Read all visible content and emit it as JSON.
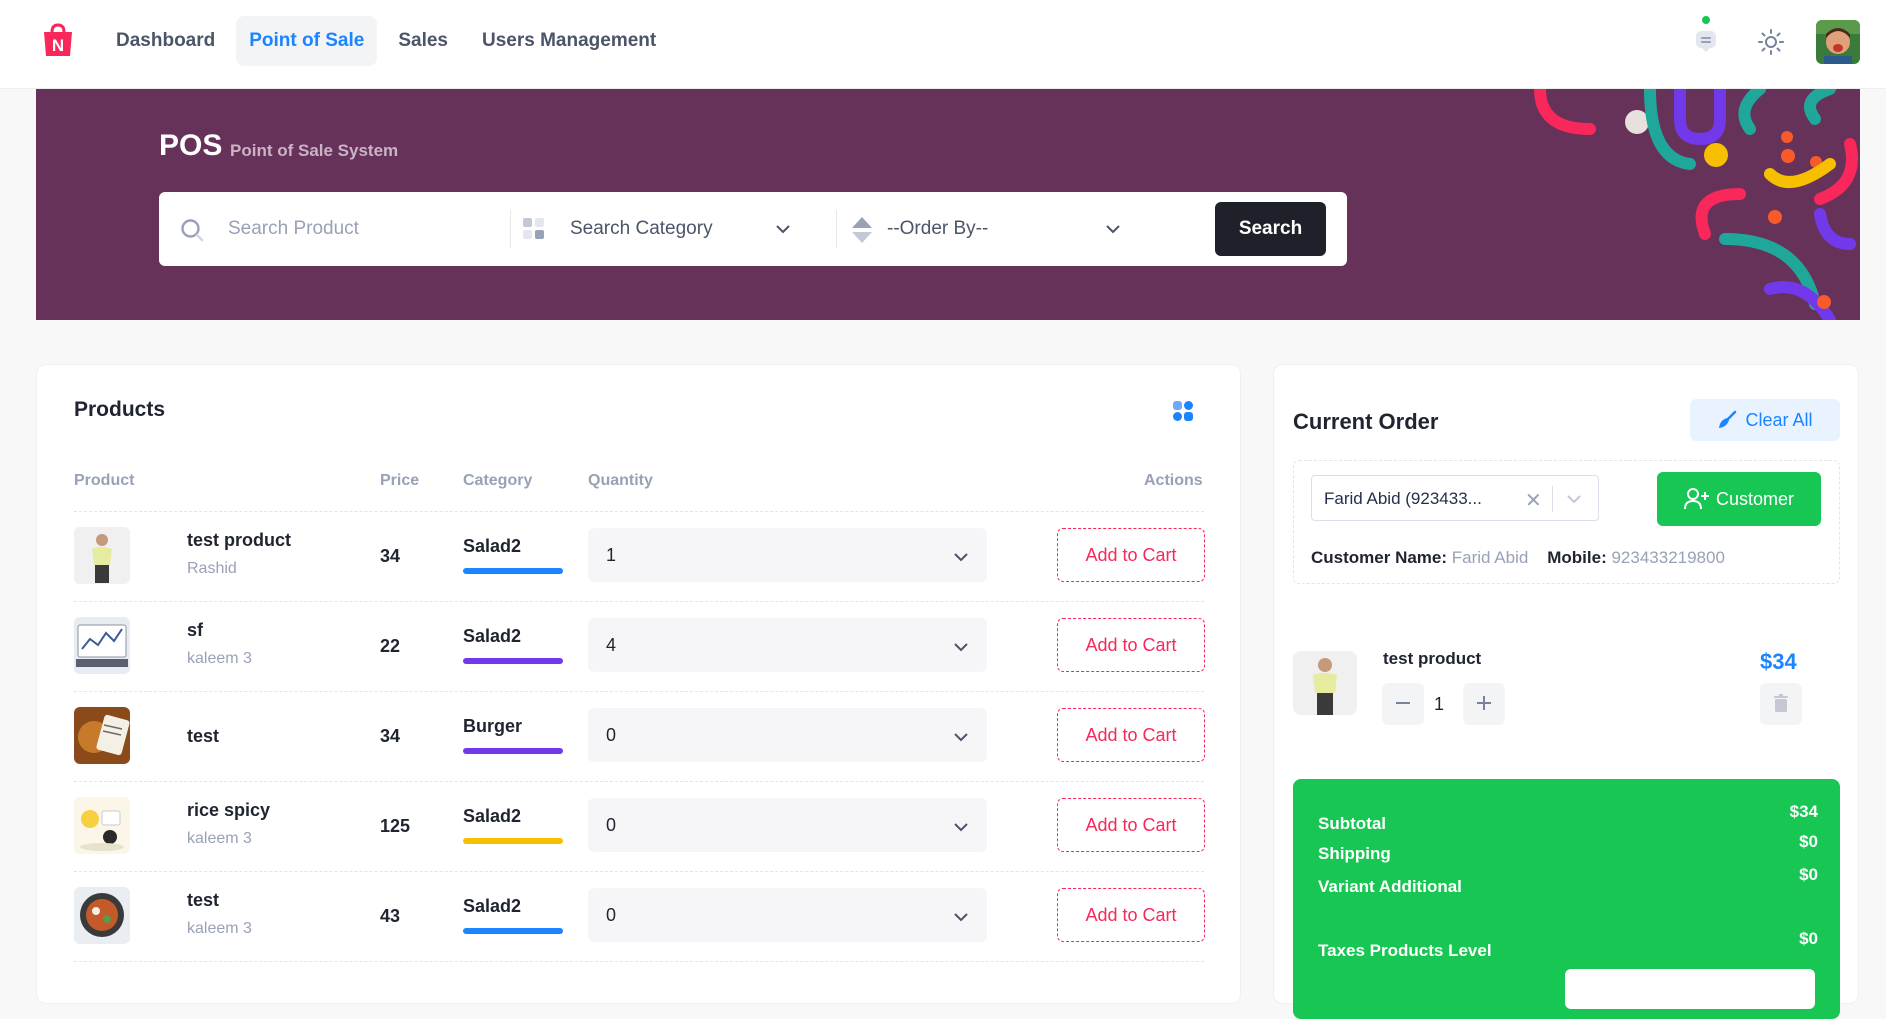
{
  "nav": {
    "items": [
      {
        "label": "Dashboard",
        "active": false
      },
      {
        "label": "Point of Sale",
        "active": true
      },
      {
        "label": "Sales",
        "active": false
      },
      {
        "label": "Users Management",
        "active": false
      }
    ]
  },
  "banner": {
    "title": "POS",
    "subtitle": "Point of Sale System",
    "search_placeholder": "Search Product",
    "category_placeholder": "Search Category",
    "order_by": "--Order By--",
    "search_button": "Search"
  },
  "products": {
    "title": "Products",
    "columns": {
      "product": "Product",
      "price": "Price",
      "category": "Category",
      "quantity": "Quantity",
      "actions": "Actions"
    },
    "add_label": "Add to Cart",
    "rows": [
      {
        "name": "test product",
        "vendor": "Rashid",
        "price": "34",
        "category": "Salad2",
        "cat_color": "#1b84ff",
        "qty": "1"
      },
      {
        "name": "sf",
        "vendor": "kaleem 3",
        "price": "22",
        "category": "Salad2",
        "cat_color": "#7239ea",
        "qty": "4"
      },
      {
        "name": "test",
        "vendor": "",
        "price": "34",
        "category": "Burger",
        "cat_color": "#7239ea",
        "qty": "0"
      },
      {
        "name": "rice spicy",
        "vendor": "kaleem 3",
        "price": "125",
        "category": "Salad2",
        "cat_color": "#f6c000",
        "qty": "0"
      },
      {
        "name": "test",
        "vendor": "kaleem 3",
        "price": "43",
        "category": "Salad2",
        "cat_color": "#1b84ff",
        "qty": "0"
      }
    ]
  },
  "order": {
    "title": "Current Order",
    "clear_all": "Clear All",
    "customer_select": "Farid Abid (923433...",
    "customer_button": "Customer",
    "customer_name_label": "Customer Name:",
    "customer_name": "Farid Abid",
    "mobile_label": "Mobile:",
    "mobile": "923433219800",
    "item": {
      "name": "test product",
      "price": "$34",
      "qty": "1"
    },
    "totals": [
      {
        "label": "Subtotal",
        "value": "$34"
      },
      {
        "label": "Shipping",
        "value": "$0"
      },
      {
        "label": "Variant Additional",
        "value": "$0"
      },
      {
        "label": "Taxes Products Level",
        "value": "$0"
      }
    ]
  },
  "colors": {
    "primary": "#1b84ff",
    "success": "#17c653",
    "danger": "#f8285a",
    "banner": "#663259"
  }
}
